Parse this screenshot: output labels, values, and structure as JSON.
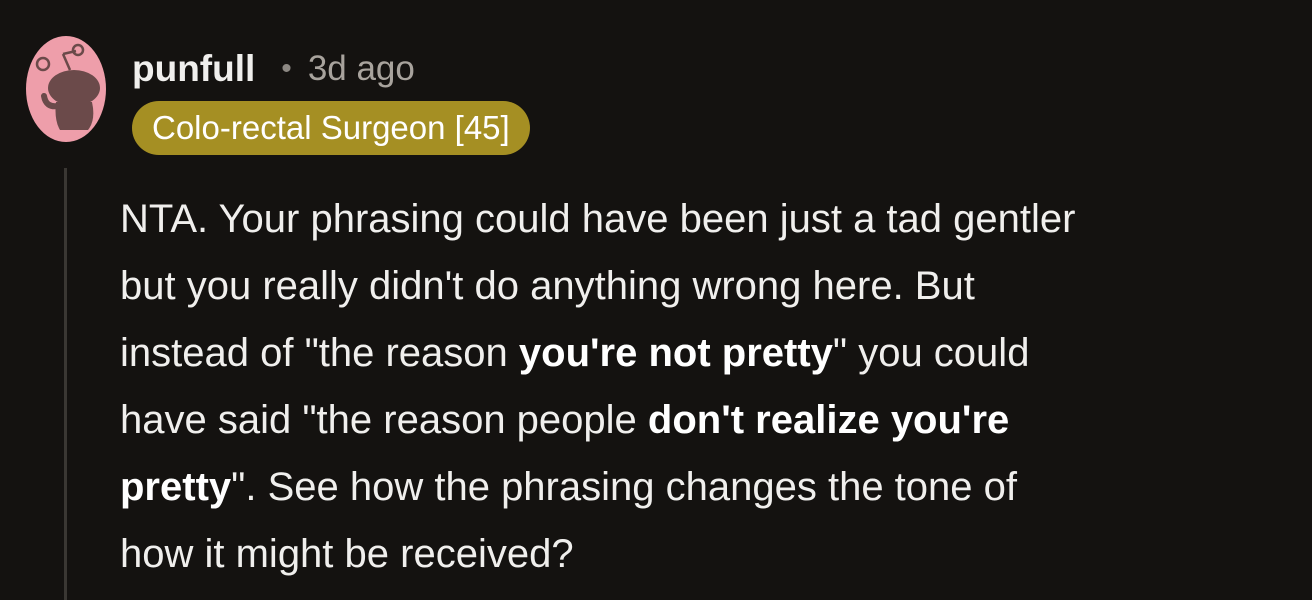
{
  "comment": {
    "author": "punfull",
    "separator": "•",
    "timestamp": "3d ago",
    "flair": "Colo-rectal Surgeon [45]",
    "avatar_icon": "snoo-avatar-icon",
    "colors": {
      "background": "#141210",
      "flair_background": "#a58f23",
      "avatar_background": "#ee9eaa",
      "thread_line": "#3a3733"
    },
    "body": [
      {
        "segments": [
          {
            "text": "NTA. Your phrasing could have been just a tad gentler",
            "bold": false
          }
        ]
      },
      {
        "segments": [
          {
            "text": "but you really didn't do anything wrong here. But",
            "bold": false
          }
        ]
      },
      {
        "segments": [
          {
            "text": "instead of \"the reason ",
            "bold": false
          },
          {
            "text": "you're not pretty",
            "bold": true
          },
          {
            "text": "\" you could",
            "bold": false
          }
        ]
      },
      {
        "segments": [
          {
            "text": "have said \"the reason people ",
            "bold": false
          },
          {
            "text": "don't realize you're",
            "bold": true
          }
        ]
      },
      {
        "segments": [
          {
            "text": "pretty",
            "bold": true
          },
          {
            "text": "\". See how the phrasing changes the tone of",
            "bold": false
          }
        ]
      },
      {
        "segments": [
          {
            "text": "how it might be received?",
            "bold": false
          }
        ]
      }
    ]
  }
}
